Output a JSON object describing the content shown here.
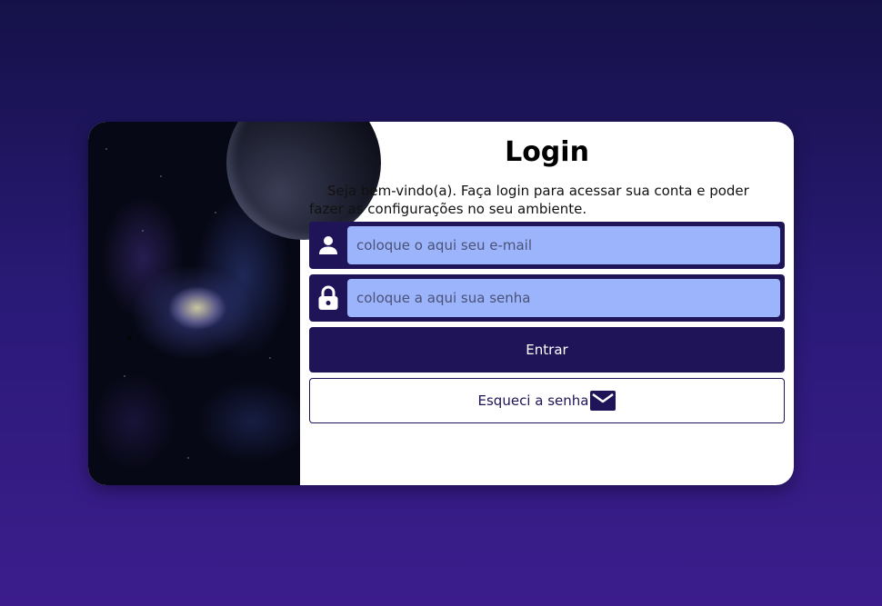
{
  "login": {
    "title": "Login",
    "subtitle": "Seja bem-vindo(a). Faça login para acessar sua conta e poder fazer as configurações no seu ambiente.",
    "email": {
      "placeholder": "coloque o aqui seu e-mail",
      "value": "",
      "icon": "user-icon"
    },
    "password": {
      "placeholder": "coloque a aqui sua senha",
      "value": "",
      "icon": "lock-icon"
    },
    "submit_label": "Entrar",
    "forgot_label": "Esqueci a senha",
    "forgot_icon": "mail-icon"
  },
  "colors": {
    "background_top": "#151148",
    "background_bottom": "#3c1c8c",
    "primary": "#1f1457",
    "input_bg": "#9bb4fb",
    "card_bg": "#ffffff"
  }
}
